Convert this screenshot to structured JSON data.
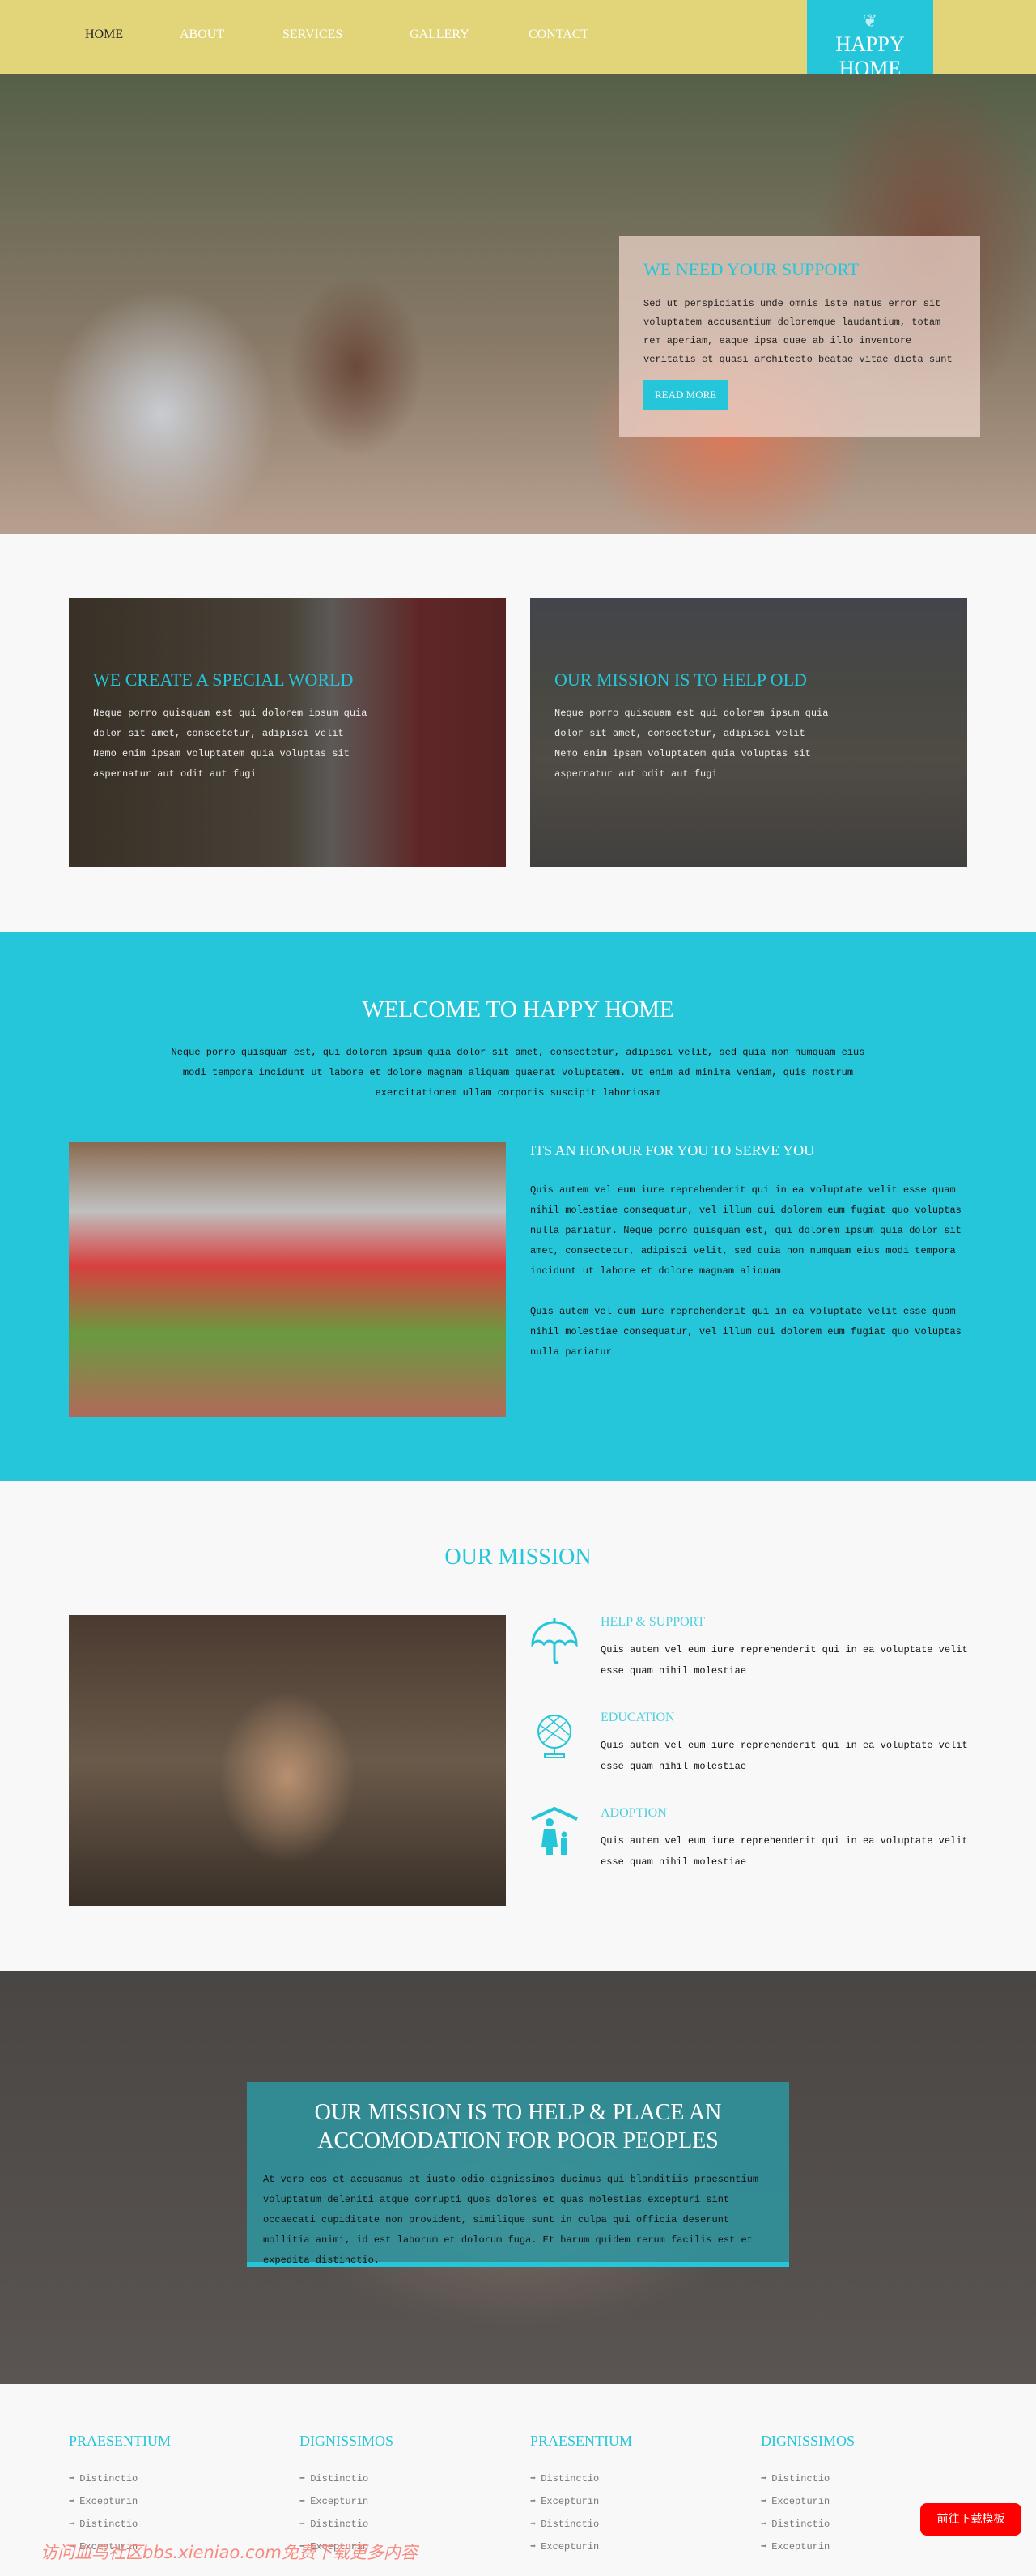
{
  "nav": {
    "items": [
      "HOME",
      "ABOUT",
      "SERVICES",
      "GALLERY",
      "CONTACT"
    ],
    "active": "HOME"
  },
  "logo": {
    "line1": "HAPPY",
    "line2": "HOME"
  },
  "hero": {
    "title": "WE NEED YOUR SUPPORT",
    "text": "Sed ut perspiciatis unde omnis iste natus error sit voluptatem accusantium doloremque laudantium, totam rem aperiam, eaque ipsa quae ab illo inventore veritatis et quasi architecto beatae vitae dicta sunt",
    "button": "READ MORE"
  },
  "cards": [
    {
      "title": "WE CREATE A SPECIAL WORLD",
      "text": "Neque porro quisquam est qui dolorem ipsum quia dolor sit amet, consectetur, adipisci velit Nemo enim ipsam voluptatem quia voluptas sit aspernatur aut odit aut fugi"
    },
    {
      "title": "OUR MISSION IS TO HELP OLD",
      "text": "Neque porro quisquam est qui dolorem ipsum quia dolor sit amet, consectetur, adipisci velit Nemo enim ipsam voluptatem quia voluptas sit aspernatur aut odit aut fugi"
    }
  ],
  "welcome": {
    "title": "WELCOME TO HAPPY HOME",
    "intro": "Neque porro quisquam est, qui dolorem ipsum quia dolor sit amet, consectetur, adipisci velit, sed quia non numquam eius modi tempora incidunt ut labore et dolore magnam aliquam quaerat voluptatem. Ut enim ad minima veniam, quis nostrum exercitationem ullam corporis suscipit laboriosam",
    "subtitle": "ITS AN HONOUR FOR YOU TO SERVE YOU",
    "p1": "Quis autem vel eum iure reprehenderit qui in ea voluptate velit esse quam nihil molestiae consequatur, vel illum qui dolorem eum fugiat quo voluptas nulla pariatur. Neque porro quisquam est, qui dolorem ipsum quia dolor sit amet, consectetur, adipisci velit, sed quia non numquam eius modi tempora incidunt ut labore et dolore magnam aliquam",
    "p2": "Quis autem vel eum iure reprehenderit qui in ea voluptate velit esse quam nihil molestiae consequatur, vel illum qui dolorem eum fugiat quo voluptas nulla pariatur"
  },
  "mission": {
    "title": "OUR MISSION",
    "items": [
      {
        "icon": "umbrella-icon",
        "title": "HELP & SUPPORT",
        "text": "Quis autem vel eum iure reprehenderit qui in ea voluptate velit esse quam nihil molestiae"
      },
      {
        "icon": "globe-icon",
        "title": "EDUCATION",
        "text": "Quis autem vel eum iure reprehenderit qui in ea voluptate velit esse quam nihil molestiae"
      },
      {
        "icon": "family-house-icon",
        "title": "ADOPTION",
        "text": "Quis autem vel eum iure reprehenderit qui in ea voluptate velit esse quam nihil molestiae"
      }
    ]
  },
  "banner": {
    "title": "OUR MISSION IS TO HELP & PLACE AN ACCOMODATION FOR POOR PEOPLES",
    "text": "At vero eos et accusamus et iusto odio dignissimos ducimus qui blanditiis praesentium voluptatum deleniti atque corrupti quos dolores et quas molestias excepturi sint occaecati cupiditate non provident, similique sunt in culpa qui officia deserunt mollitia animi, id est laborum et dolorum fuga. Et harum quidem rerum facilis est et expedita distinctio."
  },
  "footer": {
    "columns": [
      {
        "title": "PRAESENTIUM",
        "links": [
          "Distinctio",
          "Excepturin",
          "Distinctio",
          "Excepturin"
        ]
      },
      {
        "title": "DIGNISSIMOS",
        "links": [
          "Distinctio",
          "Excepturin",
          "Distinctio",
          "Excepturin"
        ]
      },
      {
        "title": "PRAESENTIUM",
        "links": [
          "Distinctio",
          "Excepturin",
          "Distinctio",
          "Excepturin"
        ]
      },
      {
        "title": "DIGNISSIMOS",
        "links": [
          "Distinctio",
          "Excepturin",
          "Distinctio",
          "Excepturin"
        ]
      }
    ]
  },
  "watermark": "访问血鸟社区bbs.xieniao.com免费下载更多内容",
  "download_button": "前往下载模板",
  "colors": {
    "accent": "#26c6da",
    "nav_bg": "#e2d479",
    "download": "#ff0000"
  }
}
